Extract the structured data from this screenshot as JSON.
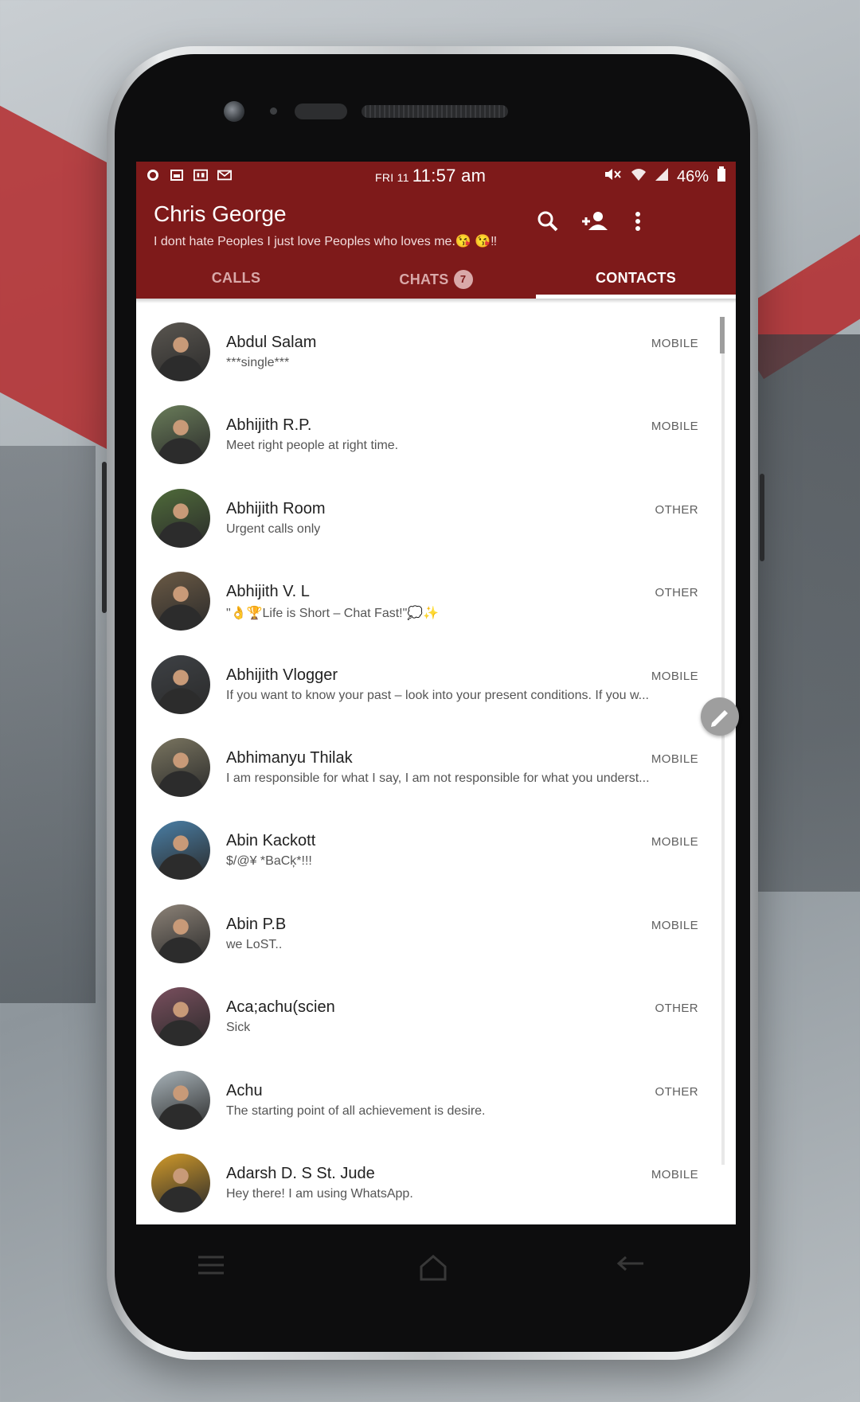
{
  "status_bar": {
    "day": "FRI 11",
    "time": "11:57 am",
    "battery": "46%",
    "left_icons": [
      "whatsapp-icon",
      "photo-icon",
      "4g-lte-icon",
      "mail-icon"
    ],
    "right_icons": [
      "mute-icon",
      "wifi-icon",
      "signal-icon",
      "battery-icon"
    ]
  },
  "header": {
    "title": "Chris George",
    "subtitle": "I dont hate Peoples I just love Peoples who loves me.😘 😘‼",
    "actions": [
      "search-icon",
      "add-contact-icon",
      "more-vert-icon"
    ]
  },
  "tabs": [
    {
      "label": "CALLS",
      "active": false
    },
    {
      "label": "CHATS",
      "badge": "7",
      "active": false
    },
    {
      "label": "CONTACTS",
      "active": true
    }
  ],
  "contacts": [
    {
      "name": "Abdul Salam",
      "status": "***single***",
      "type": "MOBILE",
      "avatar": "#5a5650"
    },
    {
      "name": "Abhijith R.P.",
      "status": "Meet right people at right time.",
      "type": "MOBILE",
      "avatar": "#6a7d5a"
    },
    {
      "name": "Abhijith Room",
      "status": "Urgent calls only",
      "type": "OTHER",
      "avatar": "#4f6b3a"
    },
    {
      "name": "Abhijith V. L",
      "status": "\"👌🏆Life is Short – Chat Fast!\"💭✨",
      "type": "OTHER",
      "avatar": "#6b5a45"
    },
    {
      "name": "Abhijith Vlogger",
      "status": "If you want to know your past – look into your present conditions. If you w...",
      "type": "MOBILE",
      "avatar": "#3e4145"
    },
    {
      "name": "Abhimanyu Thilak",
      "status": "I am responsible for what I say, I am not responsible for what you underst...",
      "type": "MOBILE",
      "avatar": "#7a7560"
    },
    {
      "name": "Abin Kackott",
      "status": "$/@¥ *BaCķ*!!!",
      "type": "MOBILE",
      "avatar": "#4a7fa6"
    },
    {
      "name": "Abin P.B",
      "status": "we LoST..",
      "type": "MOBILE",
      "avatar": "#8d8378"
    },
    {
      "name": "Aca;achu(scien",
      "status": "Sick",
      "type": "OTHER",
      "avatar": "#7a4f5e"
    },
    {
      "name": "Achu",
      "status": "The starting point of all achievement is desire.",
      "type": "OTHER",
      "avatar": "#a9b4ba"
    },
    {
      "name": "Adarsh D. S St. Jude",
      "status": "Hey there! I am using WhatsApp.",
      "type": "MOBILE",
      "avatar": "#d19a2a"
    }
  ],
  "colors": {
    "accent": "#7e1a1a",
    "tab_inactive": "#d9a9a9",
    "fab": "#9e9e9e"
  }
}
